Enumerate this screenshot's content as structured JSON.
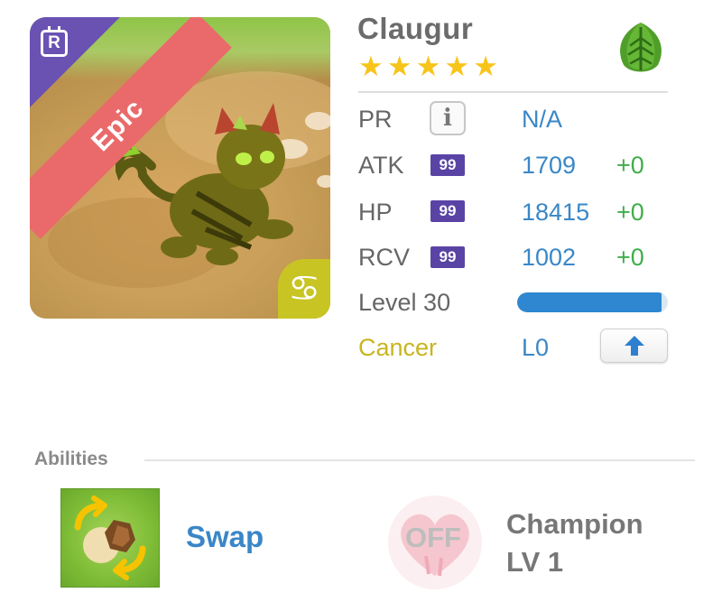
{
  "monster": {
    "name": "Claugur",
    "rarity": "Epic",
    "rarity_color": "#ea6a6b",
    "stars": 5,
    "type_badge": "R",
    "element_icon": "leaf-icon",
    "zodiac_symbol": "♋"
  },
  "stats": {
    "pr": {
      "label": "PR",
      "value": "N/A"
    },
    "atk": {
      "label": "ATK",
      "badge": "99",
      "value": "1709",
      "bonus": "+0"
    },
    "hp": {
      "label": "HP",
      "badge": "99",
      "value": "18415",
      "bonus": "+0"
    },
    "rcv": {
      "label": "RCV",
      "badge": "99",
      "value": "1002",
      "bonus": "+0"
    }
  },
  "level": {
    "label": "Level 30",
    "progress": 0.96
  },
  "zodiac": {
    "label": "Cancer",
    "skill_level": "L0"
  },
  "abilities": {
    "title": "Abilities",
    "skill": {
      "name": "Swap",
      "icon": "swap-icon"
    },
    "leader": {
      "status": "OFF",
      "name_line1": "Champion",
      "name_line2": "LV 1",
      "icon": "heart-icon"
    }
  },
  "colors": {
    "accent_blue": "#3a87c7",
    "bonus_green": "#3fae4a",
    "badge_purple": "#5944a5",
    "star_gold": "#f7c51a",
    "zodiac_yellow": "#c8c423"
  }
}
